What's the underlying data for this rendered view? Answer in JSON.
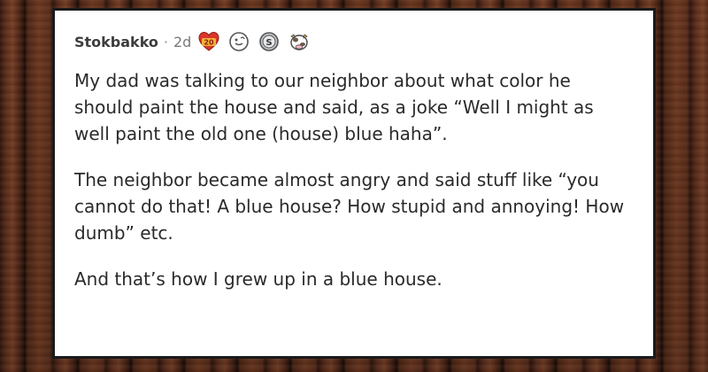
{
  "comment": {
    "username": "Stokbakko",
    "separator": "·",
    "age": "2d",
    "awards": [
      {
        "icon": "award-20-heart-icon",
        "count_label": "20"
      },
      {
        "icon": "award-face-icon"
      },
      {
        "icon": "award-silver-coin-icon",
        "symbol": "S"
      },
      {
        "icon": "award-cow-icon"
      }
    ],
    "paragraphs": [
      "My dad was talking to our neighbor about what color he should paint the house and said, as a joke “Well I might as well paint the old one (house) blue haha”.",
      "The neighbor became almost angry and said stuff like “you cannot do that! A blue house? How stupid and annoying! How dumb” etc.",
      "And that’s how I grew up in a blue house."
    ]
  },
  "colors": {
    "card_background": "#ffffff",
    "border": "#1a1a1a",
    "text": "#2a2a2a",
    "award_red": "#d9352c",
    "award_gold": "#f2b233",
    "award_silver": "#bfc3c7"
  }
}
